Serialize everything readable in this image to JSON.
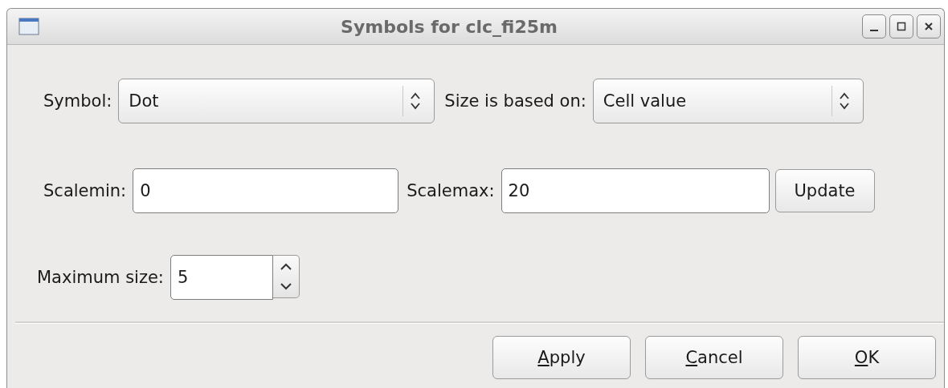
{
  "window": {
    "title": "Symbols for clc_fi25m"
  },
  "symbol": {
    "label": "Symbol:",
    "value": "Dot"
  },
  "size_based_on": {
    "label": "Size is based on:",
    "value": "Cell value"
  },
  "scalemin": {
    "label": "Scalemin:",
    "value": "0"
  },
  "scalemax": {
    "label": "Scalemax:",
    "value": "20"
  },
  "update_button": "Update",
  "maximum_size": {
    "label": "Maximum size:",
    "value": "5"
  },
  "buttons": [
    {
      "label": "Apply",
      "mnemonic_underlined": true
    },
    {
      "label": "Cancel",
      "mnemonic_underlined": true
    },
    {
      "label": "OK",
      "mnemonic_underlined": true
    }
  ]
}
